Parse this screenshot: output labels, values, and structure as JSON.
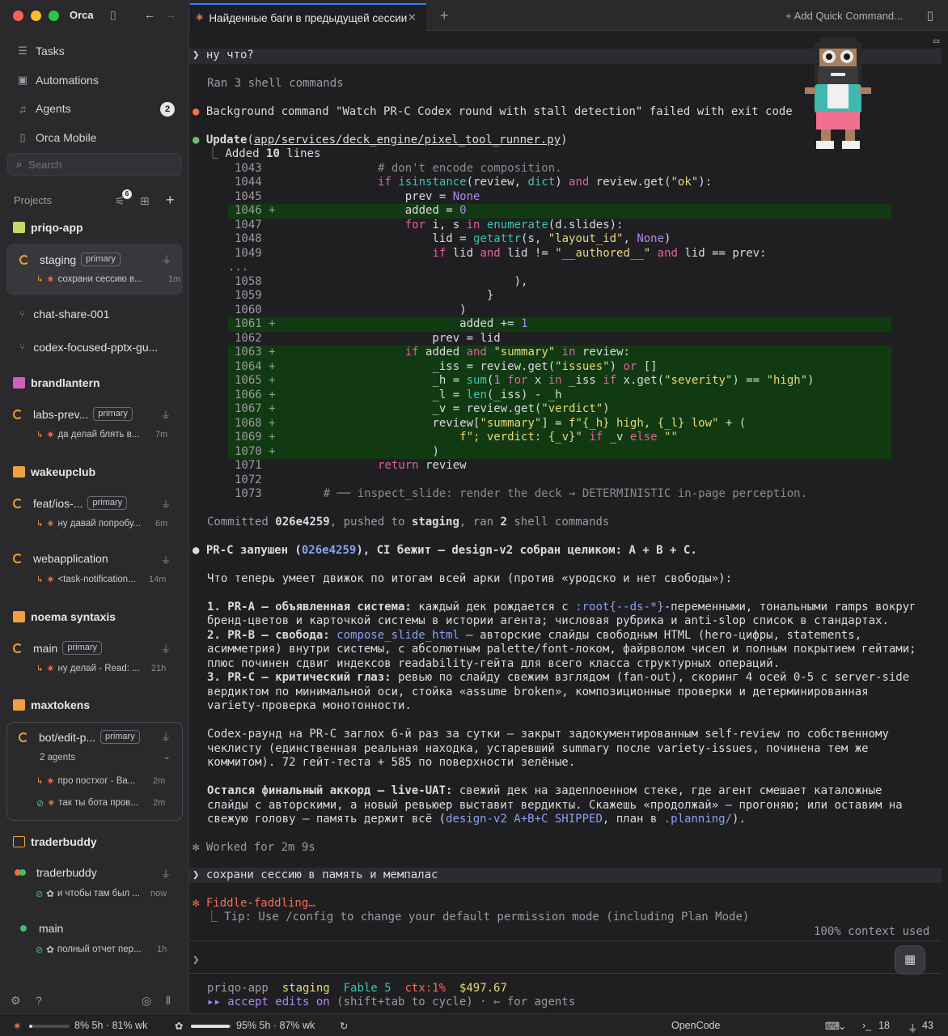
{
  "app": {
    "title": "Orca"
  },
  "sidebar": {
    "nav": [
      {
        "label": "Tasks"
      },
      {
        "label": "Automations"
      },
      {
        "label": "Agents",
        "badge": "2"
      },
      {
        "label": "Orca Mobile"
      }
    ],
    "search_placeholder": "Search",
    "projects_label": "Projects",
    "projects_badge": "6",
    "projects": [
      {
        "name": "priqo-app"
      },
      {
        "name": "brandlantern"
      },
      {
        "name": "wakeupclub"
      },
      {
        "name": "noema syntaxis"
      },
      {
        "name": "maxtokens"
      },
      {
        "name": "traderbuddy"
      }
    ],
    "sessions": {
      "staging": {
        "name": "staging",
        "tag": "primary",
        "sub": "сохрани сессию в...",
        "time": "1m"
      },
      "chat": {
        "name": "chat-share-001"
      },
      "codex": {
        "name": "codex-focused-pptx-gu..."
      },
      "labs": {
        "name": "labs-prev...",
        "tag": "primary",
        "sub": "да делай блять в...",
        "time": "7m"
      },
      "feat": {
        "name": "feat/ios-...",
        "tag": "primary",
        "sub": "ну давай попробу...",
        "time": "6m"
      },
      "webapp": {
        "name": "webapplication",
        "sub": "<task-notification...",
        "time": "14m"
      },
      "main1": {
        "name": "main",
        "tag": "primary",
        "sub": "ну делай - Read: ...",
        "time": "21h"
      },
      "bot": {
        "name": "bot/edit-p...",
        "tag": "primary",
        "agents": "2 agents",
        "sub1": "про постхог - Ва...",
        "time1": "2m",
        "sub2": "так ты бота пров...",
        "time2": "2m"
      },
      "trader": {
        "name": "traderbuddy",
        "sub": "и чтобы там был ...",
        "time": "now"
      },
      "main2": {
        "name": "main",
        "sub": "полный отчет пер...",
        "time": "1h"
      }
    }
  },
  "tab": {
    "title": "Найденные баги в предыдущей сессии",
    "quick": "+ Add Quick Command..."
  },
  "terminal": {
    "prompt1": "❯ ну что?",
    "ran3": "Ran 3 shell commands",
    "bgfail": "Background command \"Watch PR-C Codex round with stall detection\" failed with exit code",
    "update_label": "Update",
    "update_path": "app/services/deck_engine/pixel_tool_runner.py",
    "added_a": "Added ",
    "added_n": "10",
    "added_b": " lines",
    "committed_a": "Committed ",
    "committed_hash": "026e4259",
    "committed_b": ", pushed to ",
    "committed_branch": "staging",
    "committed_c": ", ran ",
    "committed_n": "2",
    "committed_d": " shell commands",
    "prc_head": "PR-C запушен (",
    "prc_hash": "026e4259",
    "prc_tail": "), CI бежит — design-v2 собран целиком: A + B + C.",
    "p_intro": "Что теперь умеет движок по итогам всей арки (против «уродско и нет свободы»):",
    "p1a": "1. PR-A — объявленная система:",
    "p1b": " каждый дек рождается с ",
    "p1c": ":root{--ds-*}",
    "p1d": "-переменными, тональными ramps вокруг",
    "p1e": "бренд-цветов и карточкой системы в истории агента; числовая рубрика и anti-slop список в стандартах.",
    "p2a": "2. PR-B — свобода:",
    "p2b": " ",
    "p2c": "compose_slide_html",
    "p2d": " — авторские слайды свободным HTML (hero-цифры, statements,",
    "p2e": "асимметрия) внутри системы, с абсолютным palette/font-локом, файрволом чисел и полным покрытием гейтами;",
    "p2f": "плюс починен сдвиг индексов readability-гейта для всего класса структурных операций.",
    "p3a": "3. PR-C — критический глаз:",
    "p3b": " ревью по слайду свежим взглядом (fan-out), скоринг 4 осей 0-5 с server-side",
    "p3c": "вердиктом по минимальной оси, стойка «assume broken», композиционные проверки и детерминированная",
    "p3d": "variety-проверка монотонности.",
    "p4a": "Codex-раунд на PR-C заглох 6-й раз за сутки — закрыт задокументированным self-review по собственному",
    "p4b": "чеклисту (единственная реальная находка, устаревший summary после variety-issues, починена тем же",
    "p4c": "коммитом). 72 гейт-теста + 585 по поверхности зелёные.",
    "p5a": "Остался финальный аккорд — live-UAT:",
    "p5b": " свежий дек на задеплоенном стеке, где агент смешает каталожные",
    "p5c": "слайды с авторскими, а новый ревьюер выставит вердикты. Скажешь «продолжай» — прогоняю; или оставим на",
    "p5d": "свежую голову — память держит всё (",
    "p5e": "design-v2 A+B+C SHIPPED",
    "p5f": ", план в ",
    "p5g": ".planning/",
    "p5h": ").",
    "worked": "✻ Worked for 2m 9s",
    "prompt2": "❯ сохрани сессию в память и мемпалас",
    "fiddle": "✻ Fiddle-faddling…",
    "tip": "  ⎿ Tip: Use /config to change your default permission mode (including Plan Mode)",
    "context": "100% context used",
    "prompt3": "❯",
    "st_project": "priqo-app",
    "st_branch": "staging",
    "st_model": "Fable 5",
    "st_ctx": "ctx:1%",
    "st_cost": "$497.67",
    "accept_a": "▸▸ accept edits on",
    "accept_b": " (shift+tab to cycle) · ← for agents"
  },
  "statusbar": {
    "u1": "8% 5h",
    "u2": "81% wk",
    "u3": "95% 5h",
    "u4": "87% wk",
    "center": "OpenCode",
    "n1": "18",
    "n2": "43"
  },
  "colors": {
    "accent": "#3a7afe",
    "added_bg": "#123a12",
    "spinner": "#f0a030"
  }
}
